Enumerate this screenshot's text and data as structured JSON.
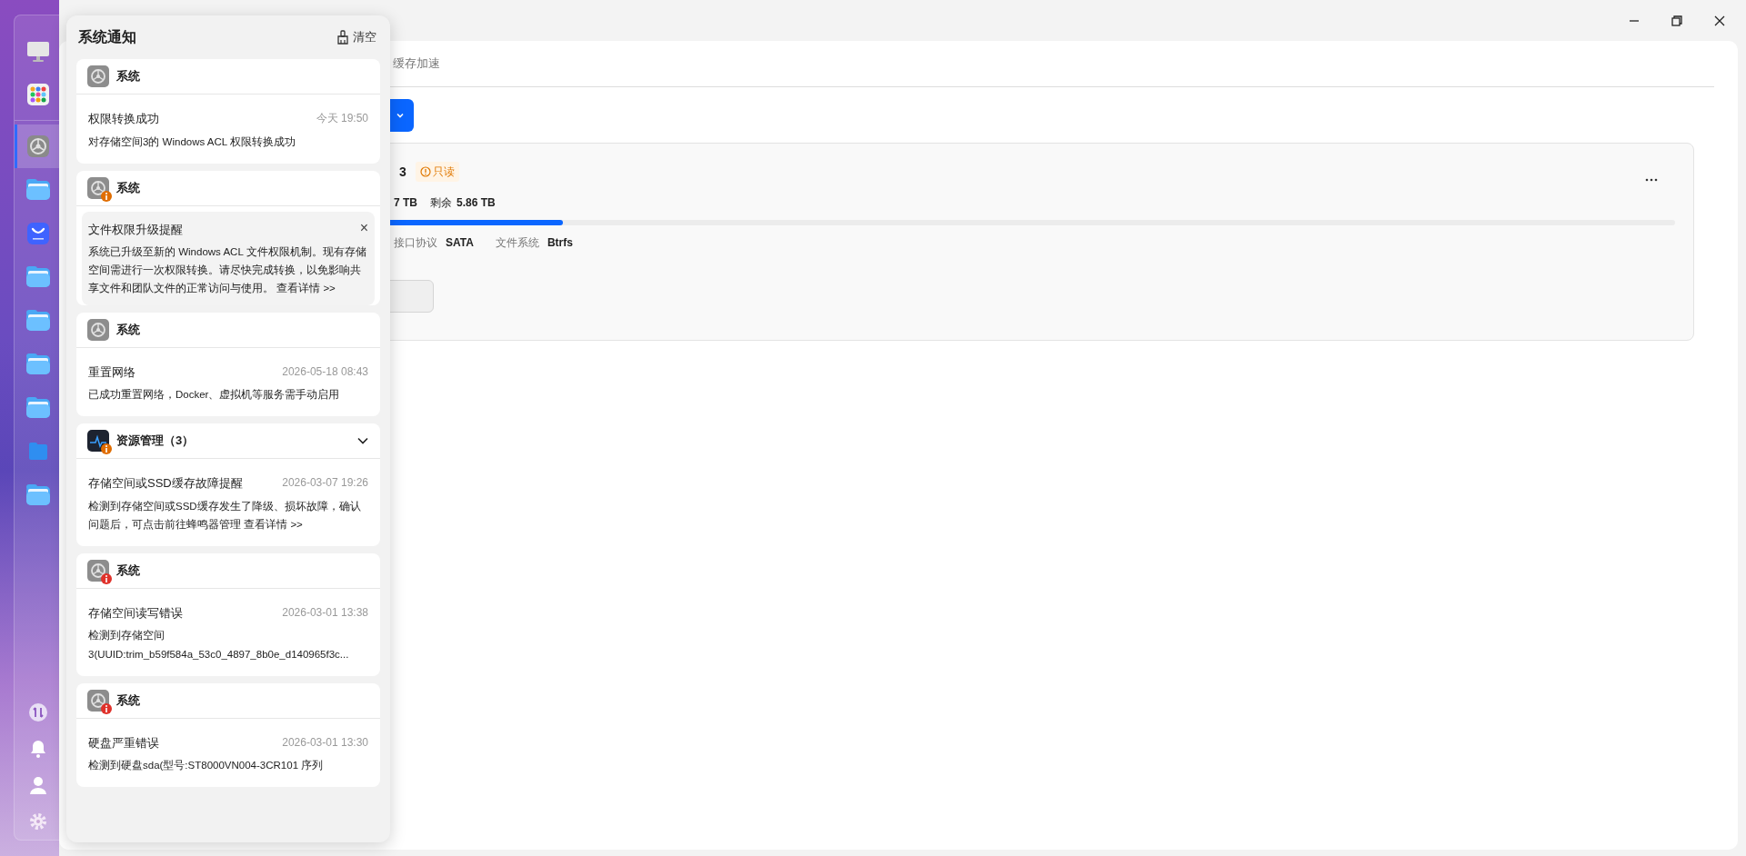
{
  "dock": {
    "items": [
      {
        "kind": "monitor",
        "selected": false
      },
      {
        "kind": "apps",
        "selected": false
      },
      {
        "kind": "settings",
        "selected": true
      },
      {
        "kind": "folder",
        "selected": false
      },
      {
        "kind": "store",
        "selected": false
      },
      {
        "kind": "folder",
        "selected": false
      },
      {
        "kind": "folder",
        "selected": false
      },
      {
        "kind": "folder",
        "selected": false
      },
      {
        "kind": "folder",
        "selected": false
      },
      {
        "kind": "folder-small",
        "selected": false
      },
      {
        "kind": "folder",
        "selected": false
      }
    ],
    "bottom": [
      {
        "kind": "transfer"
      },
      {
        "kind": "bell"
      },
      {
        "kind": "user"
      },
      {
        "kind": "gear"
      }
    ]
  },
  "window": {
    "tabs": [
      {
        "label": "缓存加速",
        "selected": false
      }
    ]
  },
  "storage_card": {
    "title": "3",
    "badge": "只读",
    "stats": [
      {
        "value": "7 TB"
      },
      {
        "label": "剩余",
        "value": "5.86 TB"
      }
    ],
    "level": 0.18,
    "details": [
      {
        "label": "接口协议",
        "value": "SATA"
      },
      {
        "label": "文件系统",
        "value": "Btrfs"
      }
    ]
  },
  "notifications": {
    "title": "系统通知",
    "clear_label": "清空",
    "groups": [
      {
        "app": "系统",
        "kind": "system",
        "collapsible": false,
        "items": [
          {
            "kind": "plain",
            "title": "权限转换成功",
            "time": "今天 19:50",
            "body": "对存储空间3的 Windows ACL 权限转换成功"
          }
        ]
      },
      {
        "app": "系统",
        "kind": "system",
        "color": "#e06d00",
        "collapsible": false,
        "items": [
          {
            "kind": "banner",
            "title": "文件权限升级提醒",
            "close": "×",
            "body": "系统已升级至新的 Windows ACL 文件权限机制。现有存储空间需进行一次权限转换。请尽快完成转换，以免影响共享文件和团队文件的正常访问与使用。",
            "link": "查看详情 >>"
          }
        ]
      },
      {
        "app": "系统",
        "kind": "system",
        "collapsible": false,
        "items": [
          {
            "kind": "plain",
            "title": "重置网络",
            "time": "2026-05-18 08:43",
            "body": "已成功重置网络，Docker、虚拟机等服务需手动启用"
          }
        ]
      },
      {
        "app": "资源管理（3）",
        "kind": "resource",
        "color": "#e06d00",
        "collapsible": true,
        "items": [
          {
            "kind": "plain",
            "title": "存储空间或SSD缓存故障提醒",
            "time": "2026-03-07 19:26",
            "body": "检测到存储空间或SSD缓存发生了降级、损坏故障，确认问题后，可点击前往蜂鸣器管理",
            "link": "查看详情 >>"
          }
        ]
      },
      {
        "app": "系统",
        "kind": "system",
        "color": "#e0322b",
        "collapsible": false,
        "items": [
          {
            "kind": "plain",
            "title": "存储空间读写错误",
            "time": "2026-03-01 13:38",
            "body": "检测到存储空间 3(UUID:trim_b59f584a_53c0_4897_8b0e_d140965f3c..."
          }
        ]
      },
      {
        "app": "系统",
        "kind": "system",
        "color": "#e0322b",
        "collapsible": false,
        "items": [
          {
            "kind": "plain",
            "title": "硬盘严重错误",
            "time": "2026-03-01 13:30",
            "body": "检测到硬盘sda(型号:ST8000VN004-3CR101 序列"
          }
        ]
      }
    ]
  }
}
